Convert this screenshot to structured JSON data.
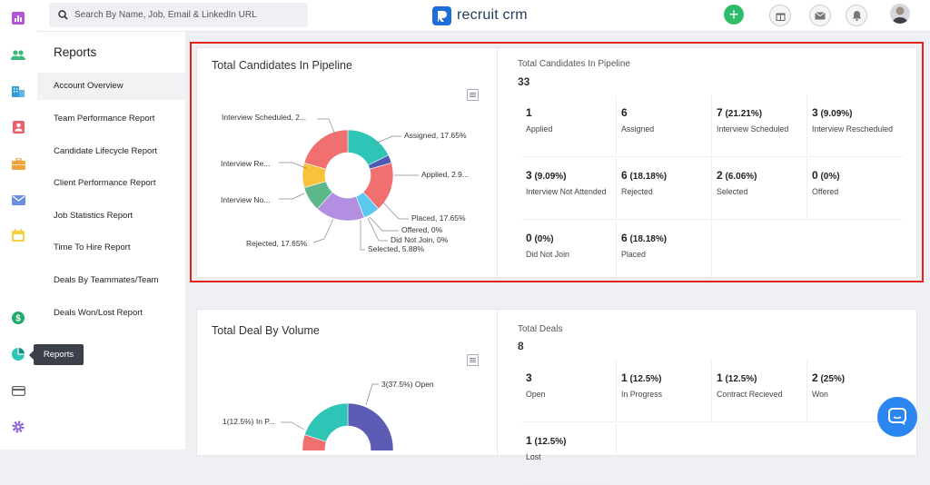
{
  "search": {
    "placeholder": "Search By Name, Job, Email & LinkedIn URL"
  },
  "brand": {
    "name": "recruit crm",
    "accent": "#1e6ed8",
    "highlight": "#e2231a"
  },
  "rail_icons": [
    "reports-bar-icon",
    "candidates-icon",
    "companies-icon",
    "contacts-icon",
    "jobs-icon",
    "email-icon",
    "calendar-icon",
    "deals-icon",
    "reports-pie-icon",
    "billing-icon",
    "settings-icon"
  ],
  "sidebar": {
    "title": "Reports",
    "items": [
      {
        "label": "Account Overview"
      },
      {
        "label": "Team Performance Report"
      },
      {
        "label": "Candidate Lifecycle Report"
      },
      {
        "label": "Client Performance Report"
      },
      {
        "label": "Job Statistics Report"
      },
      {
        "label": "Time To Hire Report"
      },
      {
        "label": "Deals By Teammates/Team"
      },
      {
        "label": "Deals Won/Lost Report"
      }
    ]
  },
  "tooltip": "Reports",
  "pipeline": {
    "chart_title": "Total Candidates In Pipeline",
    "stats_title": "Total Candidates In Pipeline",
    "total": "33",
    "cells": [
      {
        "count": "1",
        "pct": "",
        "label": "Applied"
      },
      {
        "count": "6",
        "pct": "",
        "label": "Assigned"
      },
      {
        "count": "7",
        "pct": "(21.21%)",
        "label": "Interview Scheduled"
      },
      {
        "count": "3",
        "pct": "(9.09%)",
        "label": "Interview Rescheduled"
      },
      {
        "count": "3",
        "pct": "(9.09%)",
        "label": "Interview Not Attended"
      },
      {
        "count": "6",
        "pct": "(18.18%)",
        "label": "Rejected"
      },
      {
        "count": "2",
        "pct": "(6.06%)",
        "label": "Selected"
      },
      {
        "count": "0",
        "pct": "(0%)",
        "label": "Offered"
      },
      {
        "count": "0",
        "pct": "(0%)",
        "label": "Did Not Join"
      },
      {
        "count": "6",
        "pct": "(18.18%)",
        "label": "Placed"
      }
    ]
  },
  "chart_data": [
    {
      "type": "pie",
      "title": "Total Candidates In Pipeline",
      "slices": [
        {
          "name": "Assigned",
          "value": 17.65,
          "color": "#2ec4b6"
        },
        {
          "name": "Applied",
          "value": 2.94,
          "color": "#4b5bb5"
        },
        {
          "name": "Placed",
          "value": 17.65,
          "color": "#f07070"
        },
        {
          "name": "Offered",
          "value": 0,
          "color": "#999999"
        },
        {
          "name": "Did Not Join",
          "value": 0,
          "color": "#777777"
        },
        {
          "name": "Selected",
          "value": 5.88,
          "color": "#5bc8f0"
        },
        {
          "name": "Rejected",
          "value": 17.65,
          "color": "#b48ee0"
        },
        {
          "name": "Interview Not Attended",
          "value": 8.82,
          "color": "#5cb88a"
        },
        {
          "name": "Interview Rescheduled",
          "value": 8.82,
          "color": "#f9c23c"
        },
        {
          "name": "Interview Scheduled",
          "value": 20.59,
          "color": "#f07070"
        }
      ],
      "labels": {
        "interview_scheduled": "Interview Scheduled, 2...",
        "assigned": "Assigned, 17.65%",
        "interview_rescheduled": "Interview Re...",
        "applied": "Applied, 2.9...",
        "interview_not_attended": "Interview No...",
        "placed": "Placed, 17.65%",
        "offered": "Offered, 0%",
        "did_not_join": "Did Not Join, 0%",
        "rejected": "Rejected, 17.65%",
        "selected": "Selected, 5.88%"
      }
    },
    {
      "type": "pie",
      "title": "Total Deal By Volume",
      "slices": [
        {
          "name": "Open",
          "value": 37.5,
          "color": "#5c5cb5"
        },
        {
          "name": "Lost",
          "value": 12.5,
          "color": "#f07070"
        },
        {
          "name": "In Progress",
          "value": 12.5,
          "color": "#2ec4b6"
        }
      ],
      "labels": {
        "open": "3(37.5%) Open",
        "in_progress": "1(12.5%) In P..."
      }
    }
  ],
  "deals": {
    "chart_title": "Total Deal By Volume",
    "stats_title": "Total Deals",
    "total": "8",
    "cells": [
      {
        "count": "3",
        "pct": "",
        "label": "Open"
      },
      {
        "count": "1",
        "pct": "(12.5%)",
        "label": "In Progress"
      },
      {
        "count": "1",
        "pct": "(12.5%)",
        "label": "Contract Recieved"
      },
      {
        "count": "2",
        "pct": "(25%)",
        "label": "Won"
      },
      {
        "count": "1",
        "pct": "(12.5%)",
        "label": "Lost"
      }
    ]
  }
}
